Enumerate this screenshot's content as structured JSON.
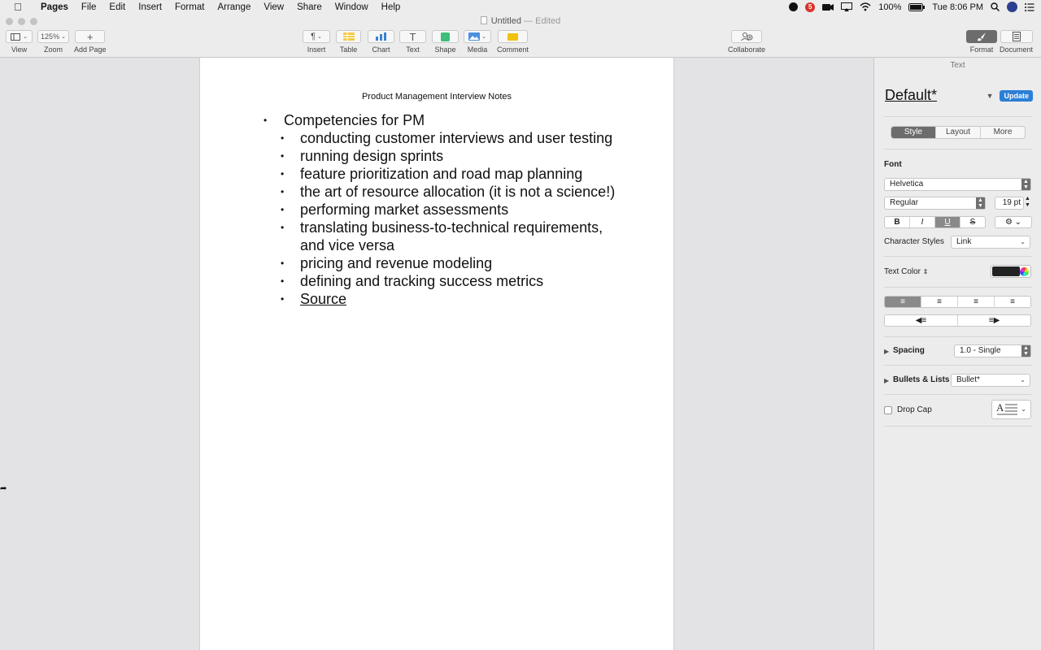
{
  "menubar": {
    "app_name": "Pages",
    "items": [
      "File",
      "Edit",
      "Insert",
      "Format",
      "Arrange",
      "View",
      "Share",
      "Window",
      "Help"
    ],
    "battery": "100%",
    "clock": "Tue 8:06 PM",
    "notification_badge": "5"
  },
  "window": {
    "title": "Untitled",
    "title_suffix": "— Edited"
  },
  "toolbar": {
    "view_label": "View",
    "zoom_value": "125%",
    "zoom_label": "Zoom",
    "add_page_label": "Add Page",
    "insert_label": "Insert",
    "table_label": "Table",
    "chart_label": "Chart",
    "text_label": "Text",
    "shape_label": "Shape",
    "media_label": "Media",
    "comment_label": "Comment",
    "collaborate_label": "Collaborate",
    "format_label": "Format",
    "document_label": "Document",
    "colors": {
      "table": "#f5c942",
      "chart": "#3b82d6",
      "shape": "#3cbf78",
      "media": "#4a8fe0",
      "comment": "#f2c10f"
    }
  },
  "document": {
    "header": "Product Management Interview Notes",
    "heading_item": "Competencies for PM",
    "items": [
      "conducting customer interviews and user testing",
      "running design sprints",
      "feature prioritization and road map planning",
      "the art of resource allocation (it is not a science!)",
      "performing market assessments",
      "translating business-to-technical requirements,",
      "and vice versa",
      "pricing and revenue modeling",
      "defining and tracking success metrics"
    ],
    "link_item": "Source"
  },
  "inspector": {
    "section_title": "Text",
    "paragraph_style": "Default*",
    "update_label": "Update",
    "tabs": [
      "Style",
      "Layout",
      "More"
    ],
    "font_label": "Font",
    "font_family": "Helvetica",
    "font_weight": "Regular",
    "font_size": "19 pt",
    "format_buttons": [
      "B",
      "I",
      "U",
      "S"
    ],
    "character_styles_label": "Character Styles",
    "character_style": "Link",
    "text_color_label": "Text Color",
    "text_color": "#222222",
    "spacing_label": "Spacing",
    "spacing_value": "1.0 - Single",
    "bullets_label": "Bullets & Lists",
    "bullets_value": "Bullet*",
    "drop_cap_label": "Drop Cap"
  }
}
